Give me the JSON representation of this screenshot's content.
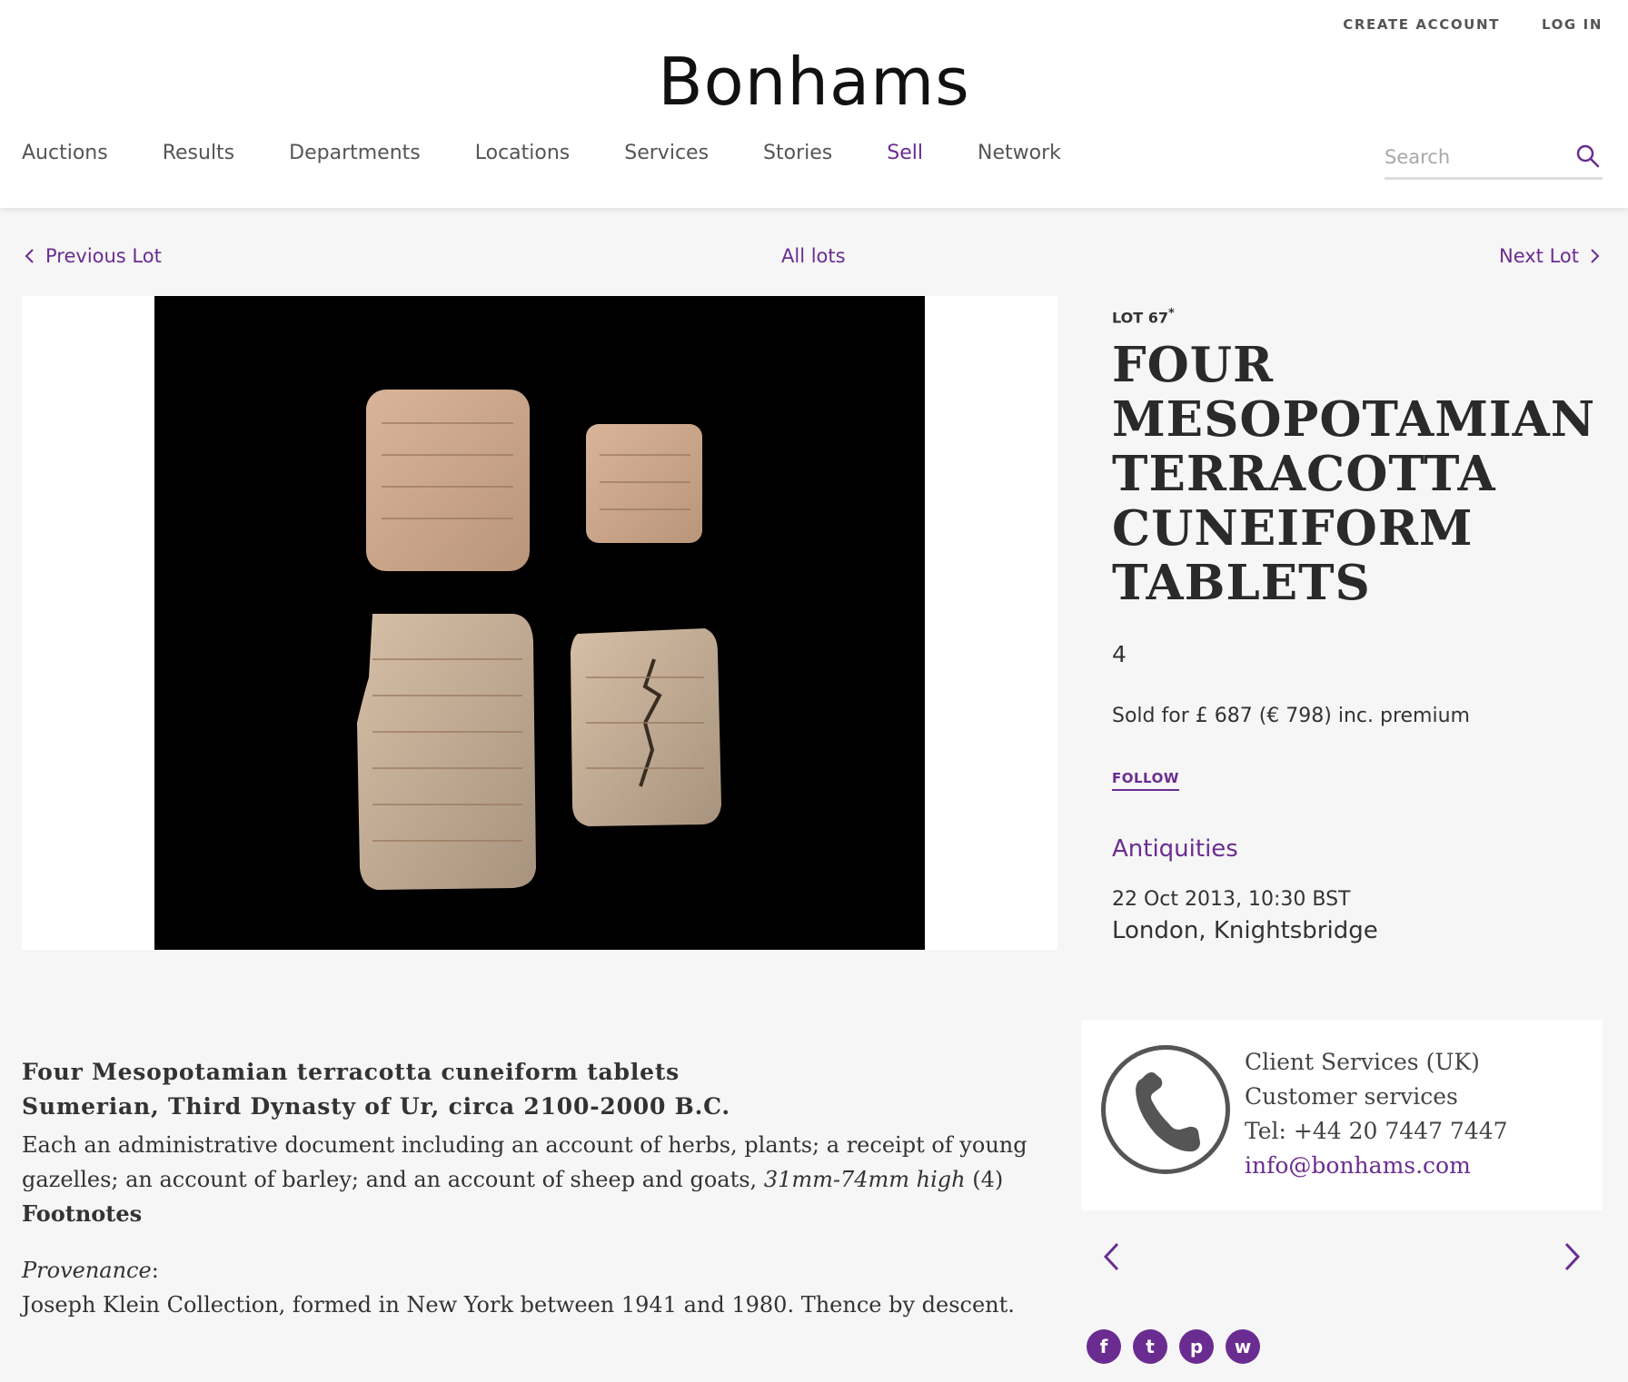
{
  "header": {
    "logo": "Bonhams",
    "create_account": "CREATE ACCOUNT",
    "log_in": "LOG IN",
    "nav": [
      {
        "label": "Auctions"
      },
      {
        "label": "Results"
      },
      {
        "label": "Departments"
      },
      {
        "label": "Locations"
      },
      {
        "label": "Services"
      },
      {
        "label": "Stories"
      },
      {
        "label": "Sell",
        "active": true
      },
      {
        "label": "Network"
      }
    ],
    "search_placeholder": "Search"
  },
  "lot_nav": {
    "previous": "Previous Lot",
    "all": "All lots",
    "next": "Next Lot"
  },
  "lot": {
    "label": "LOT 67",
    "marker": "*",
    "title": "FOUR MESOPOTAMIAN TERRACOTTA CUNEIFORM TABLETS",
    "quantity": "4",
    "sold": "Sold for £ 687 (€ 798) inc. premium",
    "follow": "FOLLOW",
    "department": "Antiquities",
    "date": "22 Oct 2013, 10:30 BST",
    "location": "London, Knightsbridge"
  },
  "description": {
    "heading1": "Four Mesopotamian terracotta cuneiform tablets",
    "heading2": "Sumerian, Third Dynasty of Ur, circa 2100-2000 B.C.",
    "body": "Each an administrative document including an account of herbs, plants; a receipt of young gazelles; an account of barley; and an account of sheep and goats,",
    "dimensions": "31mm-74mm high",
    "count": "(4)",
    "footnotes_label": "Footnotes",
    "provenance_label": "Provenance",
    "provenance_colon": ":",
    "provenance_text": "Joseph Klein Collection, formed in New York between 1941 and 1980. Thence by descent."
  },
  "contact": {
    "department": "Client Services (UK)",
    "role": "Customer services",
    "tel": "Tel: +44 20 7447 7447",
    "email": "info@bonhams.com"
  },
  "social": [
    {
      "name": "facebook-icon",
      "glyph": "f"
    },
    {
      "name": "twitter-icon",
      "glyph": "t"
    },
    {
      "name": "pinterest-icon",
      "glyph": "p"
    },
    {
      "name": "weibo-icon",
      "glyph": "w"
    }
  ],
  "colors": {
    "accent": "#6b2c91",
    "background": "#f6f6f6",
    "text": "#333333"
  }
}
